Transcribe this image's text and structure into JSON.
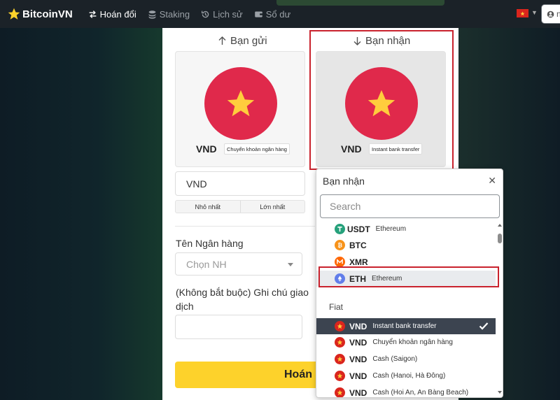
{
  "header": {
    "brand": "BitcoinVN",
    "nav": [
      {
        "label": "Hoán đổi",
        "icon": "swap-icon"
      },
      {
        "label": "Staking",
        "icon": "coins-icon"
      },
      {
        "label": "Lịch sử",
        "icon": "history-icon"
      },
      {
        "label": "Sổ dư",
        "icon": "wallet-icon"
      }
    ],
    "language_flag": "vietnam-flag-icon",
    "user_initial": "n"
  },
  "send": {
    "label": "Bạn gửi",
    "currency": "VND",
    "method": "Chuyển khoản ngân hàng"
  },
  "receive": {
    "label": "Bạn nhận",
    "currency": "VND",
    "method": "Instant bank transfer"
  },
  "form": {
    "amount_currency": "VND",
    "min_label": "Nhỏ nhất",
    "max_label": "Lớn nhất",
    "bank_label": "Tên Ngân hàng",
    "bank_placeholder": "Chọn NH",
    "note_label": "(Không bắt buộc) Ghi chú giao dịch",
    "swap_button": "Hoán đổi"
  },
  "dropdown": {
    "title": "Bạn nhận",
    "search_placeholder": "Search",
    "crypto": [
      {
        "code": "USDT",
        "network": "Ethereum"
      },
      {
        "code": "BTC",
        "network": ""
      },
      {
        "code": "XMR",
        "network": ""
      },
      {
        "code": "ETH",
        "network": "Ethereum"
      }
    ],
    "fiat_group": "Fiat",
    "fiat": [
      {
        "code": "VND",
        "network": "Instant bank transfer"
      },
      {
        "code": "VND",
        "network": "Chuyển khoản ngân hàng"
      },
      {
        "code": "VND",
        "network": "Cash (Saigon)"
      },
      {
        "code": "VND",
        "network": "Cash (Hanoi, Hà Đông)"
      },
      {
        "code": "VND",
        "network": "Cash (Hoi An, An Bàng Beach)"
      }
    ]
  },
  "colors": {
    "accent": "#fdd22b",
    "highlight_frame": "#c9222d",
    "selected_row": "#3c4450",
    "flag_red": "#e0294b",
    "star_yellow": "#ffcd3d"
  }
}
